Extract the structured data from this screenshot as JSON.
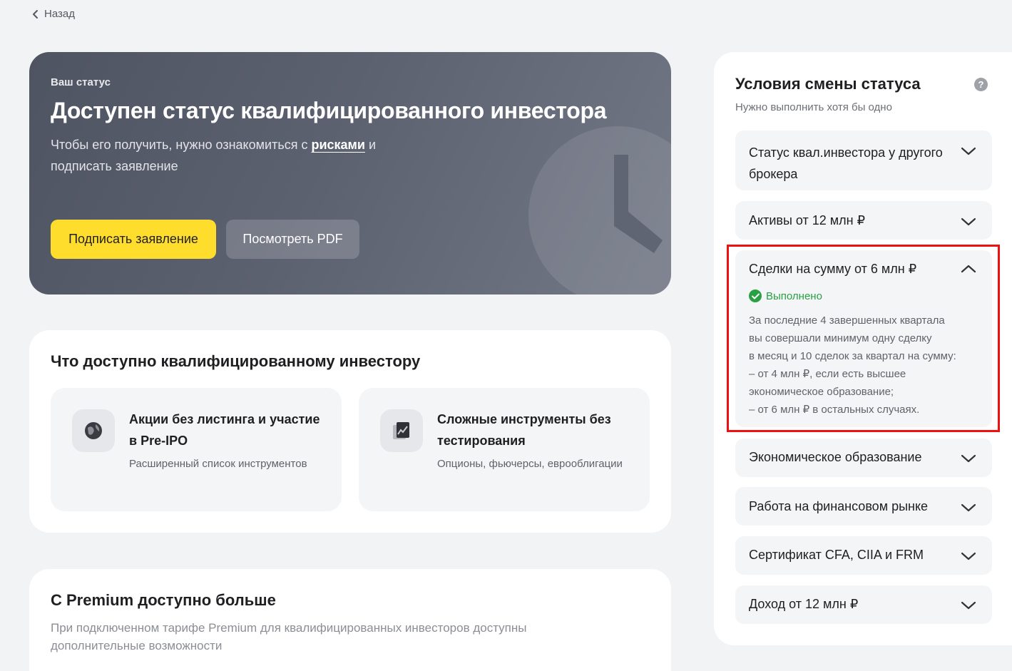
{
  "nav": {
    "back_label": "Назад"
  },
  "hero": {
    "label": "Ваш статус",
    "title": "Доступен статус квалифицированного инвестора",
    "text_before": "Чтобы его получить, нужно ознакомиться с ",
    "text_link": "рисками",
    "text_after": " и подписать заявление",
    "primary_button": "Подписать заявление",
    "secondary_button": "Посмотреть PDF"
  },
  "qualified": {
    "title": "Что доступно квалифицированному инвестору",
    "features": [
      {
        "title": "Акции без листинга и участие в Pre-IPO",
        "subtitle": "Расширенный список инструментов",
        "icon": "globe-icon"
      },
      {
        "title": "Сложные инструменты без тестирования",
        "subtitle": "Опционы, фьючерсы, еврооблигации",
        "icon": "chart-icon"
      }
    ]
  },
  "premium": {
    "title": "С Premium доступно больше",
    "text": "При подключенном тарифе Premium для квалифицированных инвесторов доступны дополнительные возможности"
  },
  "conditions": {
    "title": "Условия смены статуса",
    "subtitle": "Нужно выполнить хотя бы одно",
    "help_icon": "question-icon",
    "items": [
      {
        "label": "Статус квал.инвестора у другого брокера",
        "state": "collapsed"
      },
      {
        "label": "Активы от 12 млн ₽",
        "state": "collapsed"
      },
      {
        "label": "Сделки на сумму от 6 млн ₽",
        "state": "expanded",
        "status": "Выполнено",
        "description_lines": [
          "За последние 4 завершенных квартала",
          "вы совершали минимум одну сделку",
          "в месяц и 10 сделок за квартал на сумму:",
          "– от 4 млн ₽, если есть высшее",
          "экономическое образование;",
          "– от 6 млн ₽ в остальных случаях."
        ]
      },
      {
        "label": "Экономическое образование",
        "state": "collapsed"
      },
      {
        "label": "Работа на финансовом рынке",
        "state": "collapsed"
      },
      {
        "label": "Сертификат CFA, CIIA и FRM",
        "state": "collapsed"
      },
      {
        "label": "Доход от 12 млн ₽",
        "state": "collapsed"
      }
    ]
  },
  "colors": {
    "accent_yellow": "#ffdd2d",
    "success_green": "#29a044",
    "highlight_red": "#ee1111"
  }
}
